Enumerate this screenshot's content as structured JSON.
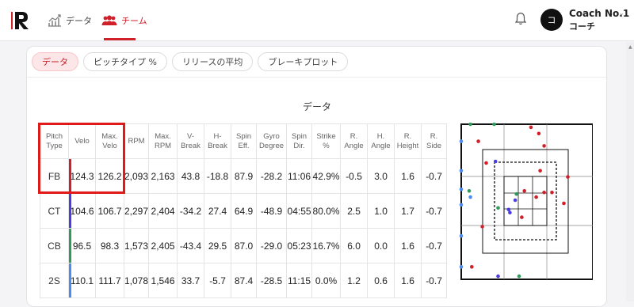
{
  "header": {
    "nav": [
      {
        "label": "データ",
        "icon": "chart-growth-icon"
      },
      {
        "label": "チーム",
        "icon": "team-icon"
      }
    ],
    "user": {
      "avatar": "コ",
      "name": "Coach No.1",
      "role": "コーチ"
    }
  },
  "tabs": [
    {
      "label": "データ",
      "active": true
    },
    {
      "label": "ピッチタイプ %",
      "active": false
    },
    {
      "label": "リリースの平均",
      "active": false
    },
    {
      "label": "ブレーキプロット",
      "active": false
    }
  ],
  "section_title": "データ",
  "table": {
    "headers": [
      [
        "Pitch",
        "Type"
      ],
      [
        "Velo"
      ],
      [
        "Max.",
        "Velo"
      ],
      [
        "RPM"
      ],
      [
        "Max.",
        "RPM"
      ],
      [
        "V-",
        "Break"
      ],
      [
        "H-",
        "Break"
      ],
      [
        "Spin",
        "Eff."
      ],
      [
        "Gyro",
        "Degree"
      ],
      [
        "Spin",
        "Dir."
      ],
      [
        "Strike",
        "%"
      ],
      [
        "R.",
        "Angle"
      ],
      [
        "H.",
        "Angle"
      ],
      [
        "R.",
        "Height"
      ],
      [
        "R.",
        "Side"
      ]
    ],
    "rows": [
      {
        "type": "FB",
        "color": "#d0202a",
        "cells": [
          "124.3",
          "126.2",
          "2,093",
          "2,163",
          "43.8",
          "-18.8",
          "87.9",
          "-28.2",
          "11:06",
          "42.9%",
          "-0.5",
          "3.0",
          "1.6",
          "-0.7"
        ]
      },
      {
        "type": "CT",
        "color": "#4a3ee0",
        "cells": [
          "104.6",
          "106.7",
          "2,297",
          "2,404",
          "-34.2",
          "27.4",
          "64.9",
          "-48.9",
          "04:55",
          "80.0%",
          "2.5",
          "1.0",
          "1.7",
          "-0.7"
        ]
      },
      {
        "type": "CB",
        "color": "#2f9a5a",
        "cells": [
          "96.5",
          "98.3",
          "1,573",
          "2,405",
          "-43.4",
          "29.5",
          "87.0",
          "-29.0",
          "05:23",
          "16.7%",
          "6.0",
          "0.0",
          "1.6",
          "-0.7"
        ]
      },
      {
        "type": "2S",
        "color": "#4a8cf0",
        "cells": [
          "110.1",
          "111.7",
          "1,078",
          "1,546",
          "33.7",
          "-5.7",
          "87.4",
          "-28.5",
          "11:15",
          "0.0%",
          "1.2",
          "0.6",
          "1.6",
          "-0.7"
        ]
      }
    ]
  },
  "plot": {
    "points": [
      {
        "c": "#d0202a",
        "x": 0.53,
        "y": 0.02
      },
      {
        "c": "#d0202a",
        "x": 0.59,
        "y": 0.06
      },
      {
        "c": "#d0202a",
        "x": 0.13,
        "y": 0.11
      },
      {
        "c": "#d0202a",
        "x": 0.63,
        "y": 0.14
      },
      {
        "c": "#d0202a",
        "x": 0.19,
        "y": 0.25
      },
      {
        "c": "#d0202a",
        "x": 0.6,
        "y": 0.3
      },
      {
        "c": "#d0202a",
        "x": 0.81,
        "y": 0.34
      },
      {
        "c": "#d0202a",
        "x": 0.48,
        "y": 0.43
      },
      {
        "c": "#d0202a",
        "x": 0.63,
        "y": 0.44
      },
      {
        "c": "#d0202a",
        "x": 0.69,
        "y": 0.44
      },
      {
        "c": "#d0202a",
        "x": 0.57,
        "y": 0.47
      },
      {
        "c": "#d0202a",
        "x": 0.78,
        "y": 0.51
      },
      {
        "c": "#d0202a",
        "x": 0.16,
        "y": 0.66
      },
      {
        "c": "#d0202a",
        "x": 0.08,
        "y": 0.92
      },
      {
        "c": "#d0202a",
        "x": 0.46,
        "y": 0.6
      },
      {
        "c": "#4a3ee0",
        "x": 0.26,
        "y": 0.24
      },
      {
        "c": "#4a3ee0",
        "x": 0.41,
        "y": 0.49
      },
      {
        "c": "#4a3ee0",
        "x": 0.36,
        "y": 0.55
      },
      {
        "c": "#4a3ee0",
        "x": 0.37,
        "y": 0.57
      },
      {
        "c": "#4a3ee0",
        "x": 0.28,
        "y": 0.98
      },
      {
        "c": "#2f9a5a",
        "x": 0.07,
        "y": 0.0
      },
      {
        "c": "#2f9a5a",
        "x": 0.25,
        "y": 0.0
      },
      {
        "c": "#2f9a5a",
        "x": 0.42,
        "y": 0.45
      },
      {
        "c": "#2f9a5a",
        "x": 0.28,
        "y": 0.54
      },
      {
        "c": "#2f9a5a",
        "x": 0.44,
        "y": 0.98
      },
      {
        "c": "#2f9a5a",
        "x": 0.06,
        "y": 0.43
      },
      {
        "c": "#4a8cf0",
        "x": 0.0,
        "y": 0.11
      },
      {
        "c": "#4a8cf0",
        "x": 0.0,
        "y": 0.3
      },
      {
        "c": "#4a8cf0",
        "x": 0.0,
        "y": 0.42
      },
      {
        "c": "#4a8cf0",
        "x": 0.07,
        "y": 0.47
      },
      {
        "c": "#4a8cf0",
        "x": 0.0,
        "y": 0.52
      },
      {
        "c": "#4a8cf0",
        "x": 0.0,
        "y": 0.72
      },
      {
        "c": "#4a8cf0",
        "x": 0.0,
        "y": 0.92
      }
    ]
  }
}
